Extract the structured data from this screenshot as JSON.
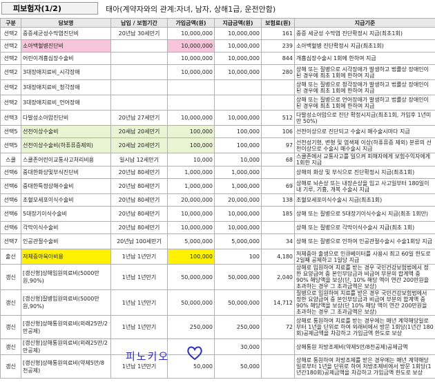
{
  "header": {
    "title": "피보험자(1/2)",
    "desc": "태아(계약자와의 관계:자녀, 남자, 상해1급, 운전안함)"
  },
  "columns": [
    "구분",
    "담보명",
    "납입 / 보험기간",
    "가입금액(원)",
    "지급금액(원)",
    "보험료(원)",
    "지급기준"
  ],
  "rows": [
    {
      "type": "선택2",
      "name": "중증세균성수막염진단비",
      "period": "20년납 30세만기",
      "amount": "10,000,000",
      "pay": "10,000,000",
      "prem": "161",
      "std": "중증 세균성 수막염 진단확정시 지급(최초1회)"
    },
    {
      "type": "선택2",
      "name": "소아백혈병진단비",
      "period": "",
      "amount": "10,000,000",
      "pay": "10,000,000",
      "prem": "239",
      "std": "소아백혈병 진단확정시 지급(최초1회)"
    },
    {
      "type": "선택2",
      "name": "어린이개흉심장수술비",
      "period": "",
      "amount": "10,000,000",
      "pay": "10,000,000",
      "prem": "844",
      "std": "개흉심장수술시 1회에 한하여 지급"
    },
    {
      "type": "선택2",
      "name": "3대장애치료비_시각장애",
      "period": "",
      "amount": "10,000,000",
      "pay": "10,000,000",
      "prem": "280",
      "std": "상해 또는 질병으로 시각장애가 발생하고 법률상 장애인이 된 경우에 최초 1회에 한하여 지급"
    },
    {
      "type": "선택2",
      "name": "3대장애치료비_청각장애",
      "period": "",
      "amount": "",
      "pay": "",
      "prem": "",
      "std": "상해 또는 질병으로 청각장애가 발생하고 법률상 장애인이 된 경우에 최초 1회에 한하여 지급"
    },
    {
      "type": "선택2",
      "name": "3대장애치료비_언어장애",
      "period": "",
      "amount": "",
      "pay": "",
      "prem": "",
      "std": "상해 또는 질병으로 언어장애가 발생하고 법률상 장애인이 된 경우에 최초 1회에 한하여 지급"
    },
    {
      "type": "선택3",
      "name": "다발성소아암진단비",
      "period": "20년납 27세만기",
      "amount": "10,000,000",
      "pay": "10,000,000",
      "prem": "512",
      "std": "다발성소아암으로 진단 확정시지급(최초1회, 가입후 1년미만 50%)"
    },
    {
      "type": "선택5",
      "name": "선천이상수술비",
      "period": "20세납 20세만기",
      "amount": "100,000",
      "pay": "100,000",
      "prem": "106",
      "std": "선천이상으로 진단되고 수술시 매수술시마다 지급"
    },
    {
      "type": "선택5",
      "name": "선천이상수술비(하퓨퓨증제외)",
      "period": "20세납 20세만기",
      "amount": "100,000",
      "pay": "100,000",
      "prem": "97",
      "std": "선천성기형, 변형 및 염색체 이상(하퓨퓨증 제외) 분류의 선천이상으로 수술시 매수술시 지급"
    },
    {
      "type": "스쿨",
      "name": "스쿨존어린이교통사고처리비용",
      "period": "일시납 12세만기",
      "amount": "10,000",
      "pay": "10,000",
      "prem": "68",
      "std": "스쿨존에서 교통사고를 일으켜 피해자에게 보험수익자에게 1회한 지급"
    },
    {
      "type": "선택6",
      "name": "중대한화상및부식진단비",
      "period": "20년납 80세만기",
      "amount": "1,000,000",
      "pay": "1,000,000",
      "prem": "",
      "std": "상해의 화상 및 부식으로 진단확정시 지급(최초1회)"
    },
    {
      "type": "선택6",
      "name": "중대한특정상해수술비",
      "period": "20년납 80세만기",
      "amount": "1,000,000",
      "pay": "1,000,000",
      "prem": "69",
      "std": "상해로 뇌손상 또는 내장손상을 입고 사고일부터 180일이내 기루, 기흉, 개복 수술시 지급"
    },
    {
      "type": "선택6",
      "name": "조혈모세포이식수술비",
      "period": "20년납 80세만기",
      "amount": "20,000,000",
      "pay": "20,000,000",
      "prem": "138",
      "std": "조혈모세포이식수술시 지급(최초1회)"
    },
    {
      "type": "선택6",
      "name": "5대장기이식수술비",
      "period": "20년납 80세만기",
      "amount": "10,000,000",
      "pay": "10,000,000",
      "prem": "185",
      "std": "상해 또는 질병으로 5대장기이식수술시 지급(최초 1회만)"
    },
    {
      "type": "선택6",
      "name": "각막이식수술비",
      "period": "20년납 80세만기",
      "amount": "10,000,000",
      "pay": "10,000,000",
      "prem": "",
      "std": "상해 또는 질병으로 각막이식수술시 지급(최초 1회)"
    },
    {
      "type": "선택7",
      "name": "인공관절수술비",
      "period": "20년납 100세만기",
      "amount": "5,000,000",
      "pay": "5,000,000",
      "prem": "34",
      "std": "상해 또는 질병으로 인하여 인공관절수술시 수술1회당 지급"
    },
    {
      "type": "출산",
      "name": "저체중아육아비용",
      "period": "1년납 1년만기",
      "amount": "100,000",
      "pay": "100",
      "prem": "4,180",
      "std": "저체중아 출생으로 인큐베이터를 사용시 최고 60일 한도로 2일째 공제하고 1일당 지급"
    },
    {
      "type": "갱신",
      "name": "[갱신형]상해입원의료비(5000만원,90%)",
      "period": "1년납 1년만기",
      "amount": "50,000,000",
      "pay": "50,000,000",
      "prem": "2,040",
      "std": "상해로 입원하여 치료를 받는 경우 국민건강보험법에서 정한 요양급여 중 본인부담금과 비급여 부분의 합계액 중 90% 해당액을 보상(단, 10% 해당 액이 연간 200만원을 초과하는 경우 그 초과금액은 보상)"
    },
    {
      "type": "갱신",
      "name": "[갱신형]질병입원의료비(5000만원,90%)",
      "period": "1년납 1년만기",
      "amount": "50,000,000",
      "pay": "50,000,000",
      "prem": "14,712",
      "std": "질병으로 입원하여 치료를 받은 경우 국민건강보험법에서 정한 요양급여 중 본인부담금과 비급여 부분의 합계액 중 90% 해당액을 보상(단 10% 해당 액이 연간 200만원을 초과하는 경우 그 초과금액은 보상)"
    },
    {
      "type": "갱신",
      "name": "[갱신형]상해통원의료비(외래25만/2만공제)",
      "period": "1년납 1년만기",
      "amount": "250,000",
      "pay": "250,000",
      "prem": "72",
      "std": "상해로 통원하여 치료를 받는 경우에는 매년 계약해당일로부터 1년을 단위로 하여 외래비에서 방문 1회당(1년간 180회)공제금액을 차감하고 가입금액 한도로 보상"
    },
    {
      "type": "갱신",
      "name": "[갱신형]상해통원의료비(외래25만/2만공제)",
      "period": "",
      "amount": "",
      "pay": "30,000",
      "prem": "",
      "std": "상해통원 처방조제비(약제5만/8천공제)공제금액"
    },
    {
      "type": "갱신",
      "name": "[갱신형]상해통원의료비(약제5만/8천공제)",
      "period": "1년납 1년만기",
      "amount": "50,000",
      "pay": "50,000",
      "prem": "",
      "std": "상해로 통원하여 처방조제를 받은 경우에는 매년 계약해당일로부터 1년을 단위로 하여 처방조제비에서 방문 1회당(1년간180회)공제금액을 차감하고 가입금액 한도로 보상"
    }
  ],
  "signature": "피노키오",
  "colors": {
    "pink": "#f7c6da",
    "green": "#e9f4d3",
    "yellow": "#fff200",
    "signature": "#2b2bcc"
  }
}
